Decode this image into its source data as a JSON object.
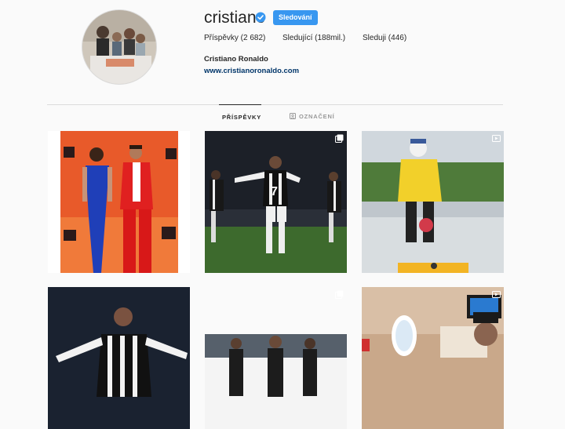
{
  "profile": {
    "username": "cristiano",
    "follow_label": "Sledování",
    "posts": "Příspěvky (2 682)",
    "followers": "Sledující (188mil.)",
    "following": "Sleduji (446)",
    "full_name": "Cristiano Ronaldo",
    "website": "www.cristianoronaldo.com"
  },
  "tabs": [
    {
      "label": "PŘÍSPĚVKY",
      "active": true,
      "icon": "grid-icon"
    },
    {
      "label": "OZNAČENÍ",
      "active": false,
      "icon": "tag-icon"
    }
  ],
  "colors": {
    "accent": "#3897f0",
    "verified": "#3897f0",
    "link": "#003569"
  },
  "grid": {
    "posts": [
      {
        "badge": "none"
      },
      {
        "badge": "carousel-icon"
      },
      {
        "badge": "video-icon"
      },
      {
        "badge": "none"
      },
      {
        "badge": "carousel-icon"
      },
      {
        "badge": "video-icon"
      }
    ]
  }
}
